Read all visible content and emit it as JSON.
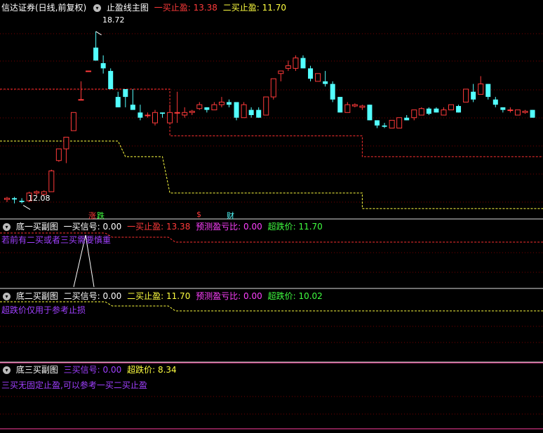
{
  "colors": {
    "up": "#ff3a3a",
    "down": "#53ffff",
    "white": "#ffffff",
    "yellow": "#ffff40",
    "magenta": "#ff40ff",
    "green": "#40ff40",
    "red": "#ff3030",
    "purple": "#a040ff",
    "divider": "#ff40a0"
  },
  "main": {
    "title_prefix": "信达证券(日线,前复权)",
    "indicator": "止盈线主图",
    "v1_label": "一买止盈:",
    "v1": "13.38",
    "v2_label": "二买止盈:",
    "v2": "11.70",
    "high_label": "18.72",
    "low_label": "12.08",
    "mark_a": "涨",
    "mark_b": "跌",
    "mark_c": "$",
    "mark_d": "财"
  },
  "sub1": {
    "name": "底一买副图",
    "sig_label": "一买信号:",
    "sig": "0.00",
    "tp_label": "一买止盈:",
    "tp": "13.38",
    "pr_label": "预测盈亏比:",
    "pr": "0.00",
    "os_label": "超跌价:",
    "os": "11.70",
    "note": "若前有二买或者三买需要慎重"
  },
  "sub2": {
    "name": "底二买副图",
    "sig_label": "二买信号:",
    "sig": "0.00",
    "tp_label": "二买止盈:",
    "tp": "11.70",
    "pr_label": "预测盈亏比:",
    "pr": "0.00",
    "os_label": "超跌价:",
    "os": "10.02",
    "note": "超跌价仅用于参考止损"
  },
  "sub3": {
    "name": "底三买副图",
    "sig_label": "三买信号:",
    "sig": "0.00",
    "os_label": "超跌价:",
    "os": "8.34",
    "note": "三买无固定止盈,可以参考一买二买止盈"
  },
  "chart_data": {
    "type": "candlestick",
    "y_range": [
      11.5,
      19.5
    ],
    "candles": [
      [
        12.25,
        12.35,
        12.15,
        12.3
      ],
      [
        12.3,
        12.35,
        12.1,
        12.25
      ],
      [
        12.2,
        12.3,
        12.1,
        12.15
      ],
      [
        12.2,
        12.55,
        12.15,
        12.5
      ],
      [
        12.5,
        12.6,
        12.4,
        12.55
      ],
      [
        12.45,
        12.6,
        12.4,
        12.55
      ],
      [
        12.55,
        13.4,
        12.55,
        13.35
      ],
      [
        13.75,
        14.2,
        13.7,
        14.2
      ],
      [
        14.2,
        14.6,
        13.65,
        14.65
      ],
      [
        14.9,
        15.6,
        14.9,
        15.6
      ],
      [
        16.1,
        16.8,
        16.1,
        16.1
      ],
      [
        17.2,
        17.2,
        17.2,
        17.2
      ],
      [
        18.1,
        18.72,
        17.6,
        17.6
      ],
      [
        17.5,
        17.8,
        17.1,
        17.3
      ],
      [
        17.2,
        17.3,
        16.5,
        16.5
      ],
      [
        16.2,
        16.4,
        15.8,
        15.8
      ],
      [
        16.5,
        16.5,
        15.8,
        16.2
      ],
      [
        15.9,
        16.5,
        15.7,
        15.7
      ],
      [
        15.6,
        15.9,
        15.3,
        15.4
      ],
      [
        15.5,
        15.6,
        15.4,
        15.5
      ],
      [
        15.2,
        15.7,
        15.1,
        15.6
      ],
      [
        15.6,
        15.6,
        15.4,
        15.55
      ],
      [
        15.2,
        15.9,
        15.2,
        15.6
      ],
      [
        15.6,
        16.4,
        15.2,
        15.6
      ],
      [
        15.5,
        15.8,
        15.4,
        15.6
      ],
      [
        15.6,
        15.7,
        15.5,
        15.65
      ],
      [
        15.75,
        16.0,
        15.7,
        15.9
      ],
      [
        15.8,
        15.8,
        15.6,
        15.7
      ],
      [
        15.7,
        16.0,
        15.7,
        15.9
      ],
      [
        15.9,
        16.2,
        15.8,
        16.0
      ],
      [
        16.0,
        16.1,
        15.8,
        15.9
      ],
      [
        16.0,
        16.0,
        15.3,
        15.4
      ],
      [
        15.4,
        16.0,
        15.4,
        15.9
      ],
      [
        15.7,
        15.8,
        15.4,
        15.5
      ],
      [
        15.7,
        15.8,
        15.4,
        15.4
      ],
      [
        15.5,
        16.2,
        15.5,
        16.2
      ],
      [
        16.2,
        16.9,
        16.1,
        16.9
      ],
      [
        17.1,
        17.2,
        16.8,
        17.2
      ],
      [
        17.3,
        17.6,
        17.2,
        17.4
      ],
      [
        17.3,
        17.8,
        17.2,
        17.7
      ],
      [
        17.7,
        17.8,
        17.3,
        17.3
      ],
      [
        17.3,
        17.4,
        16.8,
        16.9
      ],
      [
        16.8,
        17.1,
        16.8,
        17.1
      ],
      [
        16.8,
        17.2,
        16.6,
        16.7
      ],
      [
        16.7,
        16.8,
        16.0,
        16.1
      ],
      [
        16.2,
        16.2,
        15.6,
        15.6
      ],
      [
        15.6,
        16.0,
        15.6,
        15.9
      ],
      [
        15.85,
        15.95,
        15.8,
        15.9
      ],
      [
        15.8,
        15.9,
        15.7,
        15.85
      ],
      [
        15.9,
        15.9,
        15.3,
        15.3
      ],
      [
        15.3,
        15.3,
        15.0,
        15.1
      ],
      [
        15.1,
        15.2,
        15.0,
        15.05
      ],
      [
        15.0,
        15.3,
        15.0,
        15.3
      ],
      [
        15.0,
        15.4,
        15.0,
        15.4
      ],
      [
        15.4,
        15.5,
        15.3,
        15.3
      ],
      [
        15.4,
        15.7,
        15.3,
        15.7
      ],
      [
        15.5,
        15.8,
        15.5,
        15.75
      ],
      [
        15.75,
        15.8,
        15.5,
        15.55
      ],
      [
        15.75,
        15.8,
        15.6,
        15.6
      ],
      [
        15.5,
        15.8,
        15.5,
        15.7
      ],
      [
        15.7,
        15.9,
        15.7,
        15.9
      ],
      [
        15.85,
        15.9,
        15.6,
        15.6
      ],
      [
        16.0,
        16.5,
        16.0,
        16.5
      ],
      [
        16.4,
        16.7,
        16.0,
        16.1
      ],
      [
        16.3,
        17.0,
        16.3,
        16.7
      ],
      [
        16.7,
        16.7,
        16.1,
        16.2
      ],
      [
        16.1,
        16.2,
        15.8,
        15.9
      ],
      [
        15.8,
        15.8,
        15.6,
        15.7
      ],
      [
        15.7,
        15.8,
        15.6,
        15.7
      ],
      [
        15.5,
        15.7,
        15.5,
        15.7
      ],
      [
        15.6,
        15.7,
        15.55,
        15.65
      ],
      [
        15.7,
        15.7,
        15.4,
        15.4
      ]
    ],
    "red_line": [
      [
        0,
        16.5
      ],
      [
        22,
        16.5
      ],
      [
        22,
        14.7
      ],
      [
        48,
        14.7
      ],
      [
        48,
        13.9
      ],
      [
        72,
        13.9
      ]
    ],
    "yellow_line": [
      [
        0,
        14.5
      ],
      [
        15,
        14.5
      ],
      [
        16,
        13.9
      ],
      [
        21,
        13.9
      ],
      [
        22,
        12.5
      ],
      [
        48,
        12.5
      ],
      [
        48,
        11.9
      ],
      [
        72,
        11.9
      ]
    ]
  }
}
